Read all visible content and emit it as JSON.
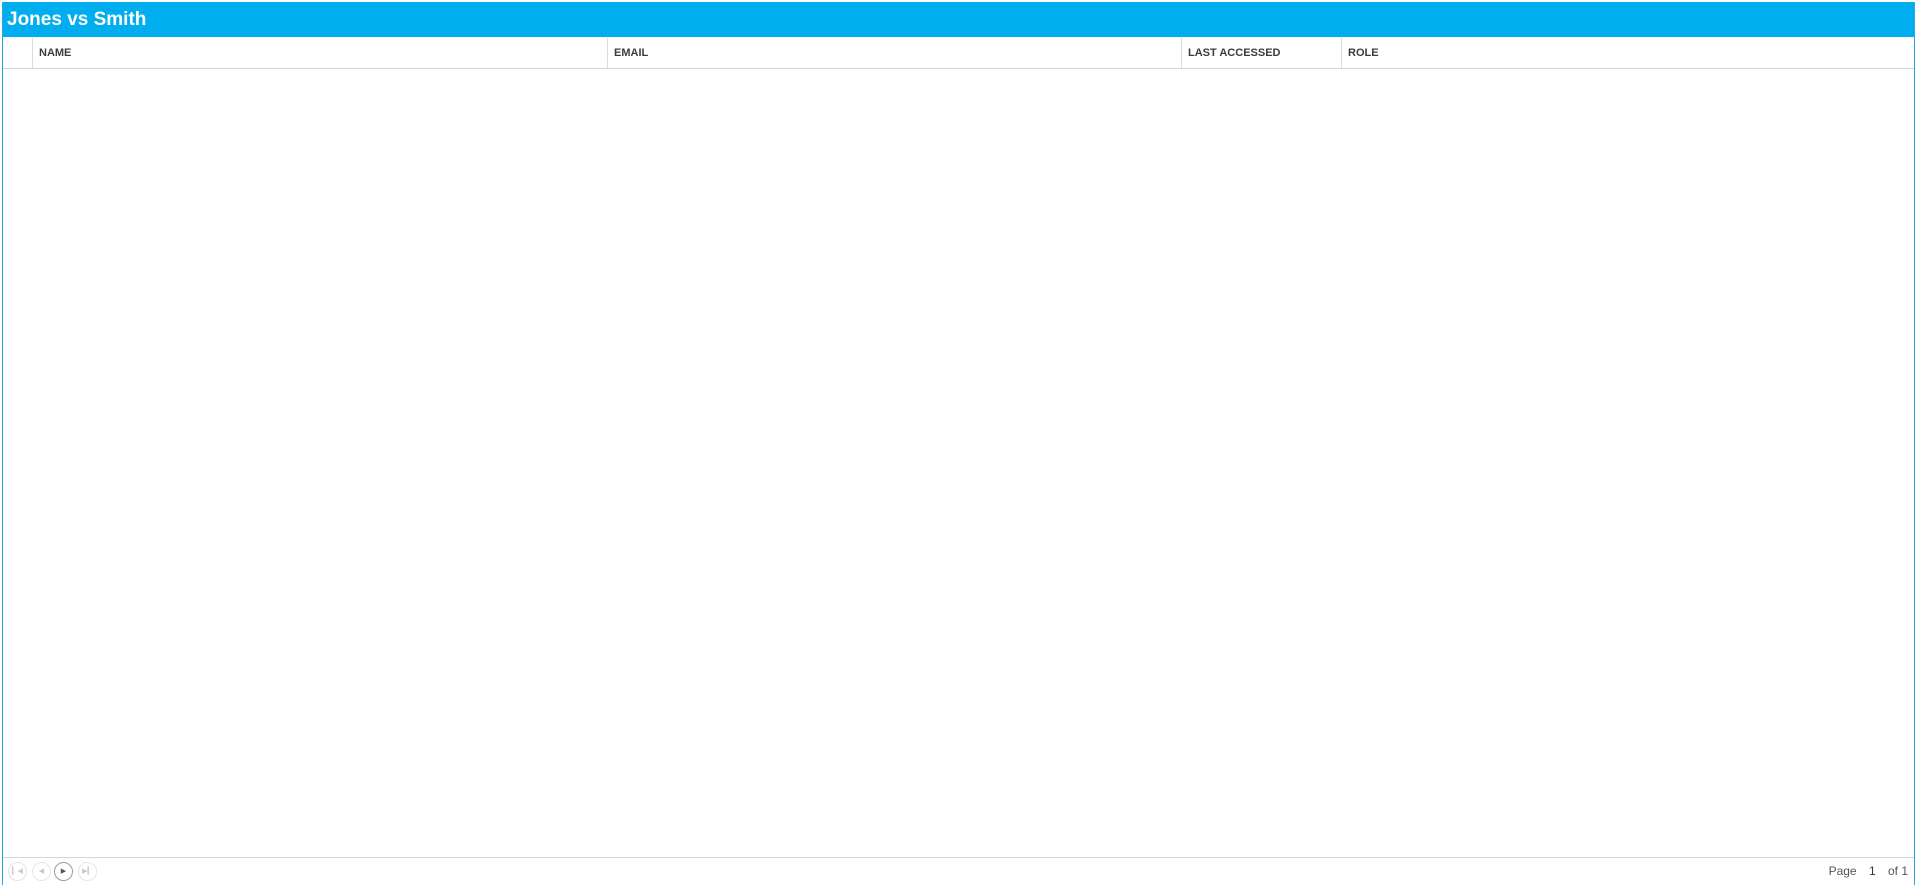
{
  "title": "Jones vs Smith",
  "grid": {
    "columns": {
      "name": "NAME",
      "email": "EMAIL",
      "last_accessed": "LAST ACCESSED",
      "role": "ROLE"
    },
    "rows": []
  },
  "pager": {
    "page_label": "Page",
    "current_page": "1",
    "of_label": "of 1",
    "icons": {
      "first": "first-page-icon",
      "prev": "previous-page-icon",
      "next": "next-page-icon",
      "last": "last-page-icon"
    }
  },
  "colors": {
    "accent": "#00aeef",
    "border": "#29a8e0"
  }
}
